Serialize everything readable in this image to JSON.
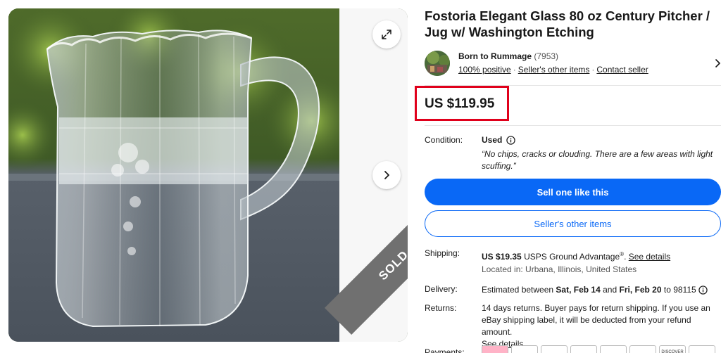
{
  "listing": {
    "title": "Fostoria Elegant Glass 80 oz Century Pitcher / Jug w/ Washington Etching",
    "price": "US $119.95",
    "sold_ribbon": "SOLD"
  },
  "seller": {
    "name": "Born to Rummage",
    "feedback_count": "(7953)",
    "positive": "100% positive",
    "other_items_link": "Seller's other items",
    "contact_link": "Contact seller"
  },
  "condition": {
    "label": "Condition:",
    "value": "Used",
    "description": "“No chips, cracks or clouding. There are a few areas with light scuffing.”"
  },
  "buttons": {
    "sell_one_like_this": "Sell one like this",
    "sellers_other_items": "Seller's other items"
  },
  "shipping": {
    "label": "Shipping:",
    "cost": "US $19.35",
    "service": "USPS Ground Advantage",
    "registered": "®",
    "details_link": "See details",
    "location": "Located in: Urbana, Illinois, United States"
  },
  "delivery": {
    "label": "Delivery:",
    "prefix": "Estimated between",
    "start": "Sat, Feb 14",
    "and": "and",
    "end": "Fri, Feb 20",
    "to": "to 98115"
  },
  "returns": {
    "label": "Returns:",
    "text": "14 days returns. Buyer pays for return shipping. If you use an eBay shipping label, it will be deducted from your refund amount.",
    "details_link": "See details"
  },
  "payments": {
    "label": "Payments:",
    "methods": [
      "",
      "",
      "",
      "",
      "",
      "",
      "DISCOVER",
      ""
    ]
  },
  "colors": {
    "accent_blue": "#0968f6",
    "price_highlight": "#e0001b",
    "sold_ribbon": "#707070"
  },
  "icons": {
    "expand": "expand-icon",
    "next": "chevron-right-icon",
    "info": "info-icon",
    "seller_chevron": "chevron-right-icon"
  }
}
